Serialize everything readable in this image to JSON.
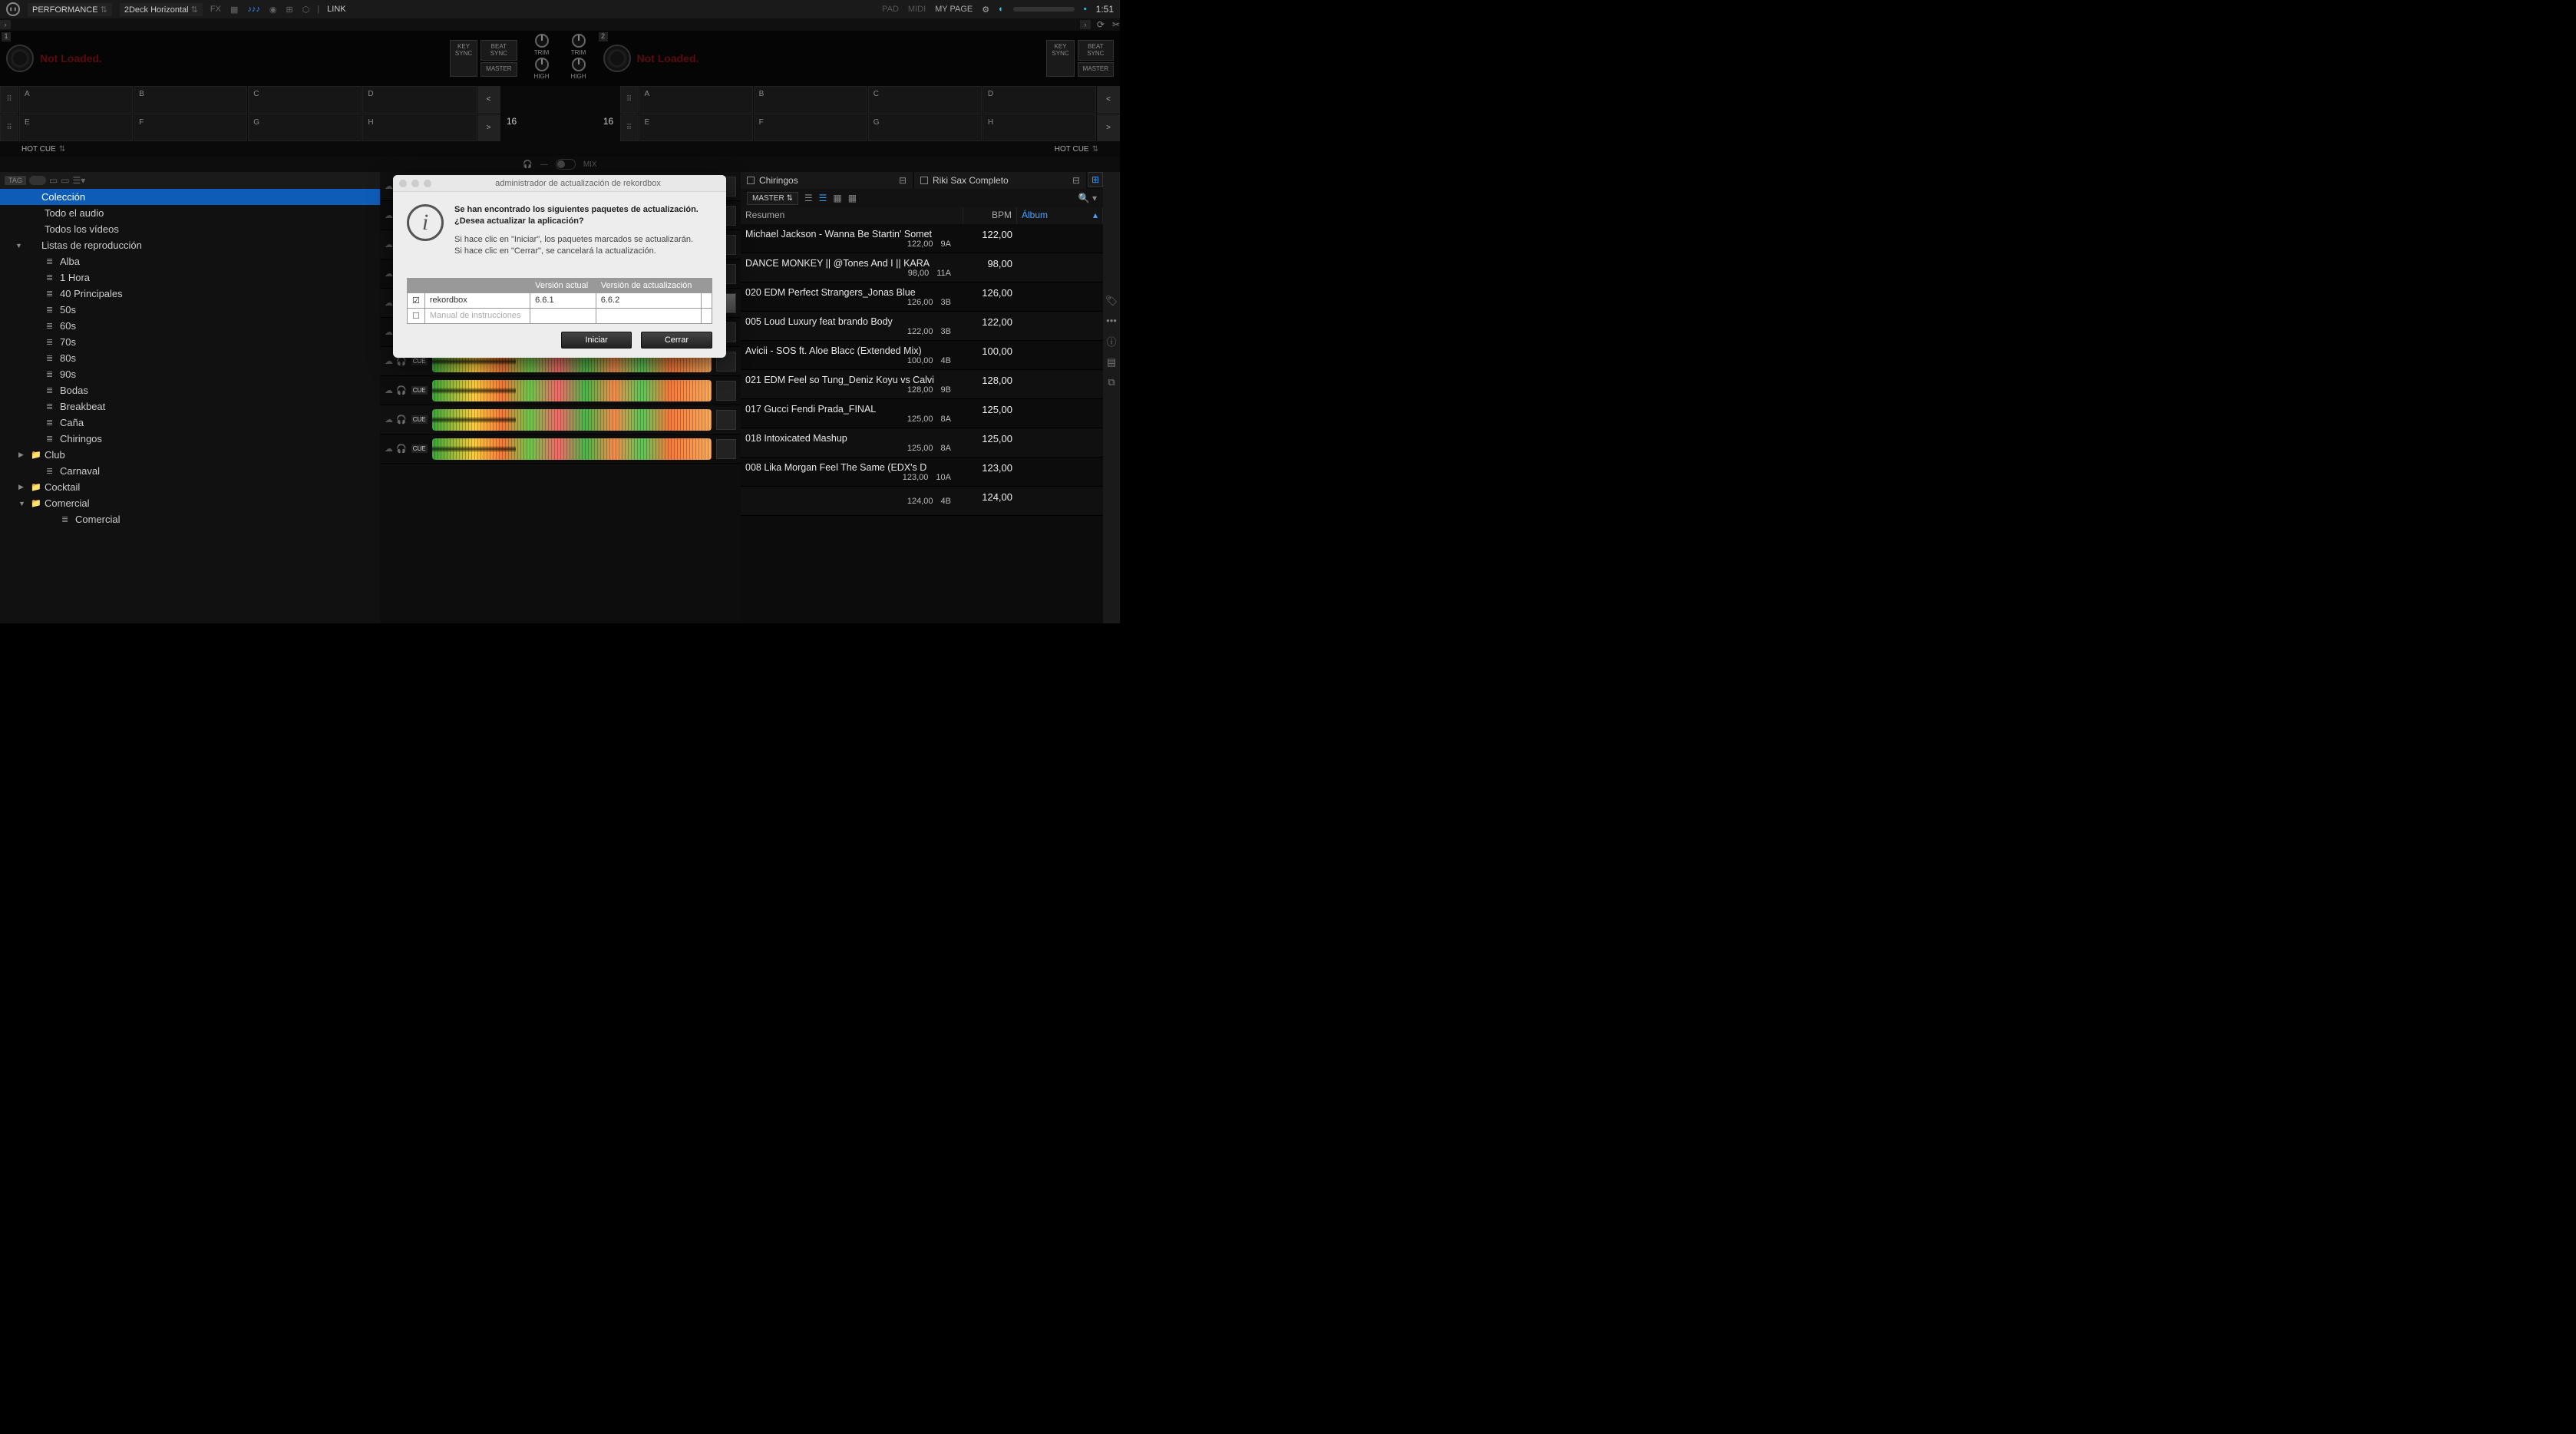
{
  "topbar": {
    "mode": "PERFORMANCE",
    "layout": "2Deck Horizontal",
    "link": "LINK",
    "pad": "PAD",
    "midi": "MIDI",
    "mypage": "MY PAGE",
    "clock": "1:51"
  },
  "deck": {
    "left_num": "1",
    "right_num": "2",
    "not_loaded": "Not Loaded.",
    "key_sync": "KEY\nSYNC",
    "beat_sync": "BEAT\nSYNC",
    "master": "MASTER",
    "trim": "TRIM",
    "high": "HIGH"
  },
  "pads": {
    "letters": [
      "A",
      "B",
      "C",
      "D",
      "E",
      "F",
      "G",
      "H"
    ],
    "count": "16",
    "hotcue": "HOT CUE"
  },
  "hp": {
    "mix": "MIX"
  },
  "sidebar_tools": {
    "tag": "TAG"
  },
  "tree": [
    {
      "label": "Colección",
      "sel": true,
      "d": 0,
      "arrow": "",
      "ico": ""
    },
    {
      "label": "Todo el audio",
      "d": 1,
      "arrow": "",
      "ico": ""
    },
    {
      "label": "Todos los vídeos",
      "d": 1,
      "arrow": "",
      "ico": ""
    },
    {
      "label": "Listas de reproducción",
      "d": 0,
      "arrow": "▼",
      "ico": ""
    },
    {
      "label": "Alba",
      "d": 2,
      "ico": "≣"
    },
    {
      "label": "1 Hora",
      "d": 2,
      "ico": "≣"
    },
    {
      "label": "40 Principales",
      "d": 2,
      "ico": "≣"
    },
    {
      "label": "50s",
      "d": 2,
      "ico": "≣"
    },
    {
      "label": "60s",
      "d": 2,
      "ico": "≣"
    },
    {
      "label": "70s",
      "d": 2,
      "ico": "≣"
    },
    {
      "label": "80s",
      "d": 2,
      "ico": "≣"
    },
    {
      "label": "90s",
      "d": 2,
      "ico": "≣"
    },
    {
      "label": "Bodas",
      "d": 2,
      "ico": "≣"
    },
    {
      "label": "Breakbeat",
      "d": 2,
      "ico": "≣"
    },
    {
      "label": "Caña",
      "d": 2,
      "ico": "≣"
    },
    {
      "label": "Chiringos",
      "d": 2,
      "ico": "≣"
    },
    {
      "label": "Club",
      "d": 1,
      "arrow": "▶",
      "ico": "📁"
    },
    {
      "label": "Carnaval",
      "d": 2,
      "ico": "≣"
    },
    {
      "label": "Cocktail",
      "d": 1,
      "arrow": "▶",
      "ico": "📁"
    },
    {
      "label": "Comercial",
      "d": 1,
      "arrow": "▼",
      "ico": "📁"
    },
    {
      "label": "Comercial",
      "d": 3,
      "ico": "≣"
    }
  ],
  "tabs": {
    "left": "Chiringos",
    "right": "Riki Sax Completo"
  },
  "toolbar": {
    "master": "MASTER"
  },
  "columns": {
    "sum": "Resumen",
    "bpm": "BPM",
    "alb": "Álbum"
  },
  "tracks": [
    {
      "title": "Michael Jackson - Wanna Be Startin' Somet",
      "bpm_s": "122,00",
      "key": "9A",
      "bpm": "122,00"
    },
    {
      "title": "DANCE MONKEY || @Tones And I || KARA",
      "bpm_s": "98,00",
      "key": "11A",
      "bpm": "98,00"
    },
    {
      "title": "020 EDM Perfect Strangers_Jonas Blue",
      "bpm_s": "126,00",
      "key": "3B",
      "bpm": "126,00"
    },
    {
      "title": "005 Loud Luxury feat brando    Body",
      "bpm_s": "122,00",
      "key": "3B",
      "bpm": "122,00"
    },
    {
      "title": "Avicii - SOS ft. Aloe Blacc (Extended Mix)",
      "bpm_s": "100,00",
      "key": "4B",
      "bpm": "100,00"
    },
    {
      "title": "021 EDM Feel so Tung_Deniz Koyu vs Calvi",
      "bpm_s": "128,00",
      "key": "9B",
      "bpm": "128,00"
    },
    {
      "title": "017 Gucci Fendi Prada_FINAL",
      "bpm_s": "125,00",
      "key": "8A",
      "bpm": "125,00"
    },
    {
      "title": "018 Intoxicated Mashup",
      "bpm_s": "125,00",
      "key": "8A",
      "bpm": "125,00"
    },
    {
      "title": "008 Lika Morgan   Feel The Same (EDX's D",
      "bpm_s": "123,00",
      "key": "10A",
      "bpm": "123,00"
    },
    {
      "title": "",
      "bpm_s": "124,00",
      "key": "4B",
      "bpm": "124,00"
    }
  ],
  "modal": {
    "title": "administrador de actualización de rekordbox",
    "heading": "Se han encontrado los siguientes paquetes de actualización.\n¿Desea actualizar la aplicación?",
    "body1": "Si hace clic en \"Iniciar\", los paquetes marcados se actualizarán.",
    "body2": "Si hace clic en \"Cerrar\", se cancelará la actualización.",
    "col_current": "Versión actual",
    "col_new": "Versión de actualización",
    "rows": [
      {
        "checked": true,
        "name": "rekordbox",
        "cur": "6.6.1",
        "new": "6.6.2"
      },
      {
        "checked": false,
        "name": "Manual de instrucciones",
        "cur": "",
        "new": "",
        "disabled": true
      }
    ],
    "btn_start": "Iniciar",
    "btn_close": "Cerrar"
  }
}
